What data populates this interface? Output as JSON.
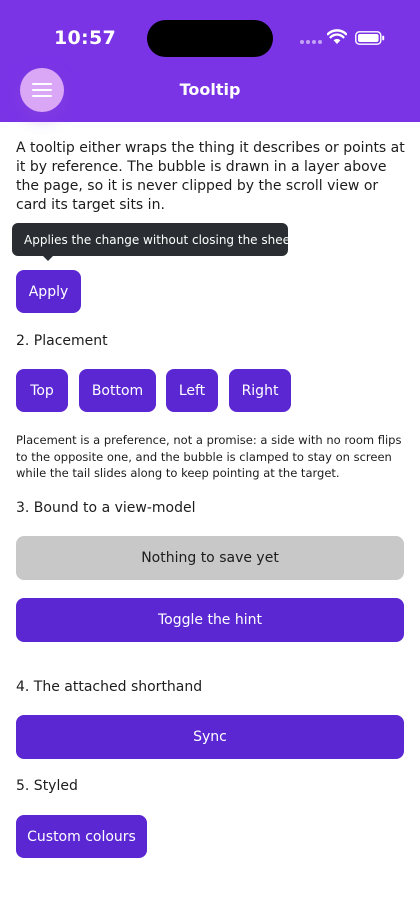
{
  "status": {
    "time": "10:57"
  },
  "header": {
    "title": "Tooltip"
  },
  "intro": "A tooltip either wraps the thing it describes or points at it by reference. The bubble is drawn in a layer above the page, so it is never clipped by the scroll view or card its target sits in.",
  "tooltip": {
    "text": "Applies the change without closing the sheet."
  },
  "apply_label": "Apply",
  "placement": {
    "heading": "2. Placement",
    "buttons": [
      "Top",
      "Bottom",
      "Left",
      "Right"
    ],
    "note": "Placement is a preference, not a promise: a side with no room flips to the opposite one, and the bubble is clamped to stay on screen while the tail slides along to keep pointing at the target."
  },
  "bound": {
    "heading": "3. Bound to a view-model",
    "disabled_label": "Nothing to save yet",
    "toggle_label": "Toggle the hint"
  },
  "attached": {
    "heading": "4. The attached shorthand",
    "sync_label": "Sync"
  },
  "styled": {
    "heading": "5. Styled",
    "custom_label": "Custom colours"
  },
  "colors": {
    "header": "#7a34e6",
    "button": "#5b27d3",
    "disabled": "#c8c8c8",
    "tooltip": "#2a2e32"
  }
}
